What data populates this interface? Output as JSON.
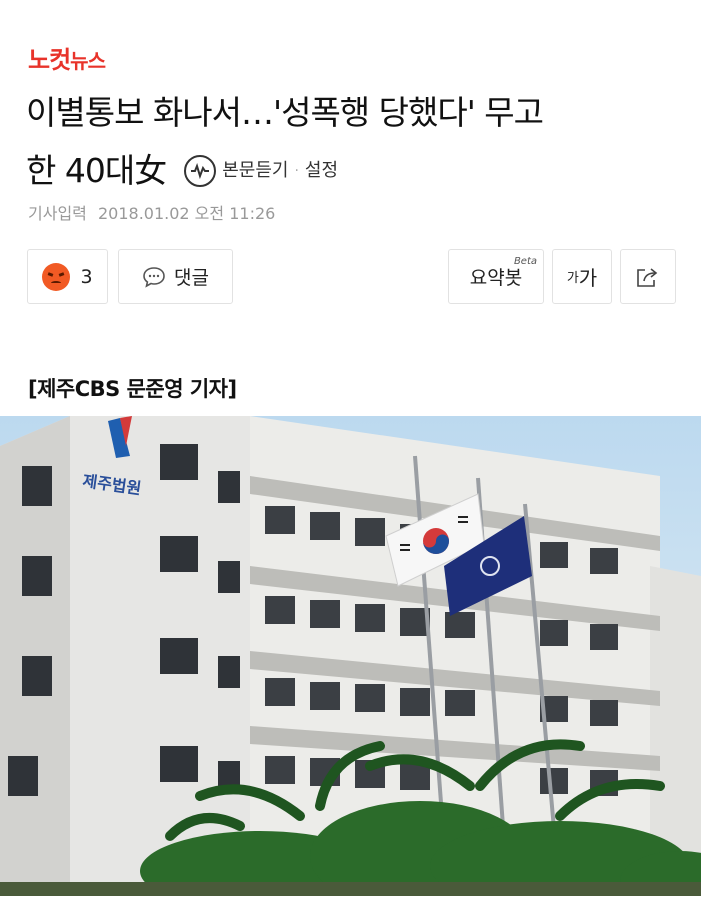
{
  "logo": {
    "part1": "노컷",
    "part2": "뉴스"
  },
  "article": {
    "headline_line1": "이별통보 화나서…'성폭행 당했다' 무고",
    "headline_line2": "한 40대女",
    "tts_label": "본문듣기",
    "settings_label": "설정",
    "meta_label": "기사입력",
    "meta_datetime": "2018.01.02 오전 11:26",
    "reporter": "[제주CBS 문준영 기자]"
  },
  "toolbar": {
    "reaction_count": "3",
    "comment_label": "댓글",
    "summary_label": "요약봇",
    "summary_badge": "Beta",
    "font_small": "가",
    "font_large": "가"
  },
  "photo": {
    "building_sign": "제주법원"
  },
  "colors": {
    "brand": "#e8332a",
    "reaction": "#f15a24",
    "meta_text": "#999999",
    "border": "#e2e2e2"
  },
  "icons": [
    "headphone-icon",
    "angry-emoji-icon",
    "comment-icon",
    "share-icon"
  ]
}
